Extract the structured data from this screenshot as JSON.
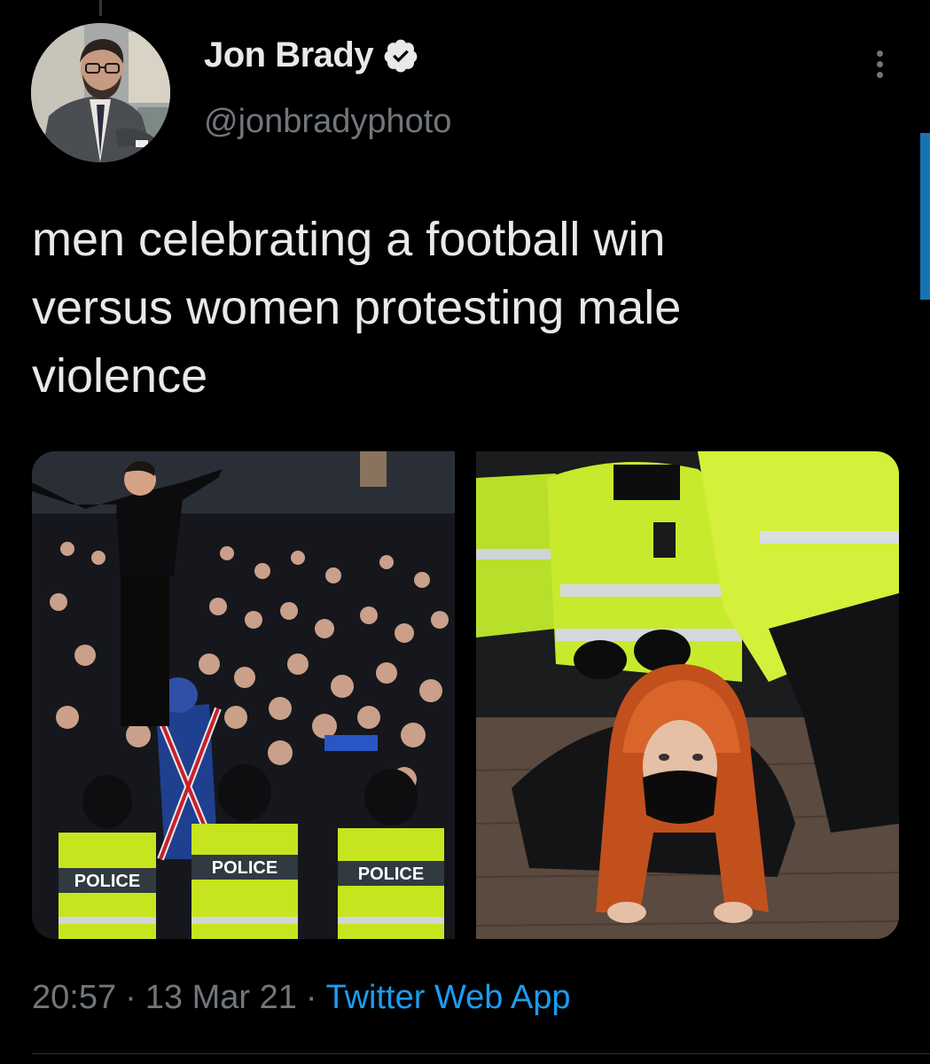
{
  "author": {
    "display_name": "Jon Brady",
    "handle": "@jonbradyphoto",
    "verified_icon": "verified-badge-icon"
  },
  "tweet": {
    "text": "men celebrating a football win\nversus women protesting male\nviolence"
  },
  "media": [
    {
      "name": "crowd-photo",
      "vest_label_1": "POLICE",
      "vest_label_2": "POLICE",
      "vest_label_3": "POLICE"
    },
    {
      "name": "arrest-photo"
    }
  ],
  "meta": {
    "time": "20:57",
    "separator": "·",
    "date": "13 Mar 21",
    "source": "Twitter Web App"
  },
  "colors": {
    "background": "#000000",
    "text_primary": "#e7e9ea",
    "text_secondary": "#71767b",
    "accent": "#1d9bf0"
  },
  "icons": {
    "more": "more-options-icon"
  }
}
